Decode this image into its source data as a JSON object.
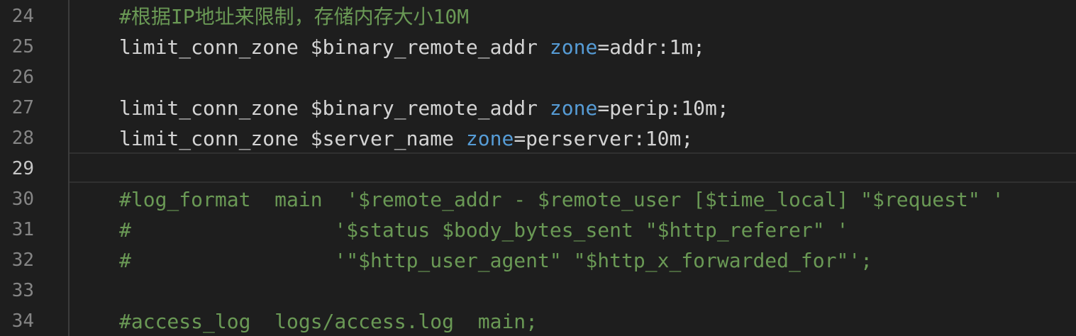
{
  "editor": {
    "language": "nginx",
    "active_line": 29,
    "colors": {
      "background": "#1e1e1e",
      "line_number": "#858585",
      "line_number_active": "#c6c6c6",
      "text": "#d4d4d4",
      "comment": "#6a9955",
      "keyword": "#569cd6",
      "current_line_border": "#303030"
    },
    "lines": [
      {
        "number": "24",
        "tokens": [
          {
            "type": "comment",
            "text": "#根据IP地址来限制，存储内存大小10M"
          }
        ]
      },
      {
        "number": "25",
        "tokens": [
          {
            "type": "text",
            "text": "limit_conn_zone $binary_remote_addr "
          },
          {
            "type": "keyword",
            "text": "zone"
          },
          {
            "type": "text",
            "text": "=addr:1m;"
          }
        ]
      },
      {
        "number": "26",
        "tokens": []
      },
      {
        "number": "27",
        "tokens": [
          {
            "type": "text",
            "text": "limit_conn_zone $binary_remote_addr "
          },
          {
            "type": "keyword",
            "text": "zone"
          },
          {
            "type": "text",
            "text": "=perip:10m;"
          }
        ]
      },
      {
        "number": "28",
        "tokens": [
          {
            "type": "text",
            "text": "limit_conn_zone $server_name "
          },
          {
            "type": "keyword",
            "text": "zone"
          },
          {
            "type": "text",
            "text": "=perserver:10m;"
          }
        ]
      },
      {
        "number": "29",
        "tokens": []
      },
      {
        "number": "30",
        "tokens": [
          {
            "type": "comment",
            "text": "#log_format  main  '$remote_addr - $remote_user [$time_local] \"$request\" '"
          }
        ]
      },
      {
        "number": "31",
        "tokens": [
          {
            "type": "comment",
            "text": "#                 '$status $body_bytes_sent \"$http_referer\" '"
          }
        ]
      },
      {
        "number": "32",
        "tokens": [
          {
            "type": "comment",
            "text": "#                 '\"$http_user_agent\" \"$http_x_forwarded_for\"';"
          }
        ]
      },
      {
        "number": "33",
        "tokens": []
      },
      {
        "number": "34",
        "tokens": [
          {
            "type": "comment",
            "text": "#access_log  logs/access.log  main;"
          }
        ]
      }
    ]
  }
}
